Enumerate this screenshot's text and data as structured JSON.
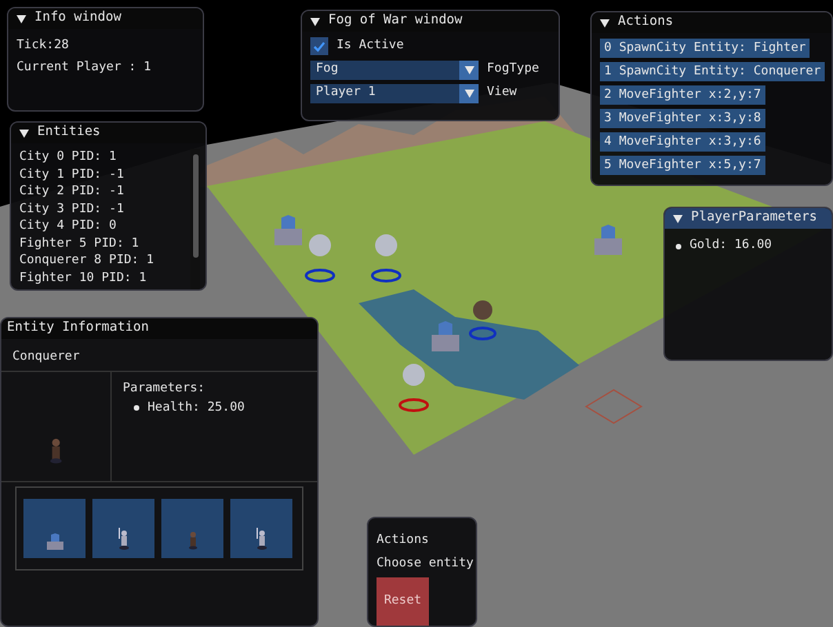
{
  "info_window": {
    "title": "Info window",
    "lines": [
      "Tick:28",
      "Current Player : 1"
    ]
  },
  "fog_window": {
    "title": "Fog of War window",
    "checkbox": {
      "label": "Is Active",
      "checked": true
    },
    "combos": [
      {
        "value": "Fog",
        "label": "FogType"
      },
      {
        "value": "Player 1",
        "label": "View"
      }
    ]
  },
  "actions_window": {
    "title": "Actions",
    "items": [
      "0 SpawnCity Entity: Fighter",
      "1 SpawnCity Entity: Conquerer",
      "2 MoveFighter x:2,y:7",
      "3 MoveFighter x:3,y:8",
      "4 MoveFighter x:3,y:6",
      "5 MoveFighter x:5,y:7"
    ]
  },
  "entities_window": {
    "title": "Entities",
    "items": [
      "City 0 PID: 1",
      "City 1 PID: -1",
      "City 2 PID: -1",
      "City 3 PID: -1",
      "City 4 PID: 0",
      "Fighter 5 PID: 1",
      "Conquerer 8 PID: 1",
      "Fighter 10 PID: 1"
    ]
  },
  "player_parameters": {
    "title": "PlayerParameters",
    "bullets": [
      "Gold: 16.00"
    ]
  },
  "entity_information": {
    "title": "Entity Information",
    "header": "Conquerer",
    "parameters_label": "Parameters:",
    "bullets": [
      "Health: 25.00"
    ],
    "slots": [
      {
        "kind": "city"
      },
      {
        "kind": "fighter"
      },
      {
        "kind": "conquerer"
      },
      {
        "kind": "fighter"
      }
    ]
  },
  "actions_panel": {
    "lines": [
      "Actions",
      "Choose entity"
    ],
    "button": "Reset"
  }
}
